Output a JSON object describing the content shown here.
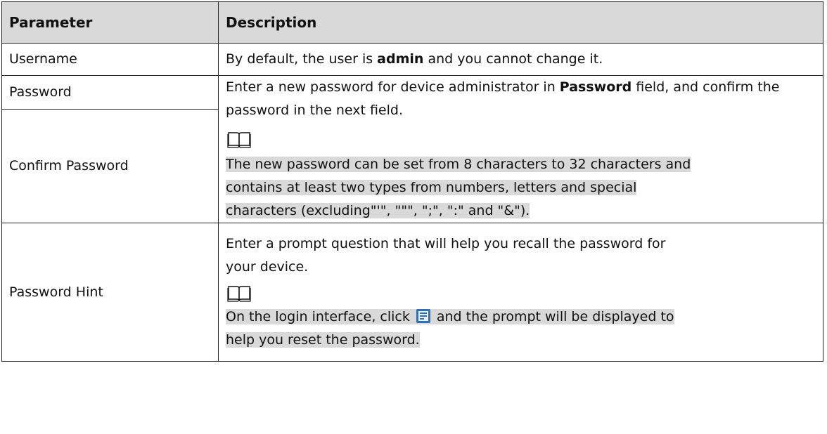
{
  "table": {
    "headers": [
      "Parameter",
      "Description"
    ],
    "username": {
      "param": "Username",
      "desc_pre": "By default, the user is ",
      "desc_bold": "admin",
      "desc_post": " and you cannot change it."
    },
    "password": {
      "param": "Password",
      "desc_pre": "Enter a new password for device administrator in ",
      "desc_bold": "Password",
      "desc_post": " field, and confirm the password in the next field.",
      "note_line1": "The new password can be set from 8 characters to 32 characters and",
      "note_line2": "contains at least two types from numbers, letters and special",
      "note_line3": "characters (excluding\"'\", \"\"\", \";\", \":\" and \"&\")."
    },
    "confirm": {
      "param": "Confirm Password"
    },
    "hint": {
      "param": "Password Hint",
      "desc_line1": "Enter a prompt question that will help you recall the password for",
      "desc_line2": "your device.",
      "note_pre": "On the login interface, click",
      "note_post": "and the prompt will be displayed to",
      "note_line2": "help you reset the password."
    }
  },
  "icons": {
    "note": "open-book-icon",
    "hint_button": "hint-button-icon"
  },
  "colors": {
    "header_bg": "#d9d9d9",
    "highlight_bg": "#d9d9d9",
    "border": "#222222",
    "icon_blue": "#2f6fb5"
  }
}
